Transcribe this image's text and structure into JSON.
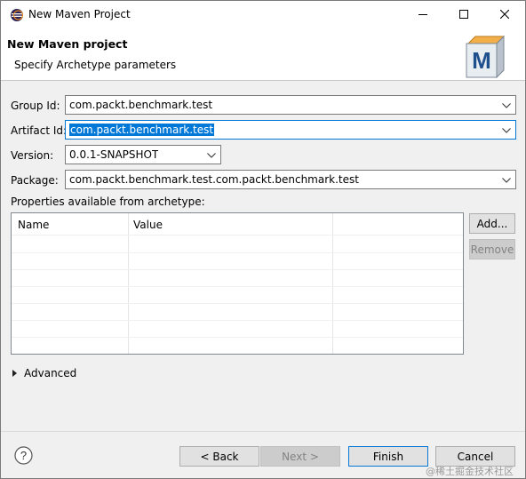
{
  "window": {
    "title": "New Maven Project",
    "controls": {
      "minimize": "minimize",
      "maximize": "maximize",
      "close": "close"
    }
  },
  "header": {
    "title": "New Maven project",
    "description": "Specify Archetype parameters",
    "logo_letter": "M"
  },
  "form": {
    "group_id": {
      "label": "Group Id:",
      "value": "com.packt.benchmark.test"
    },
    "artifact_id": {
      "label": "Artifact Id:",
      "value": "com.packt.benchmark.test"
    },
    "version": {
      "label": "Version:",
      "value": "0.0.1-SNAPSHOT"
    },
    "package": {
      "label": "Package:",
      "value": "com.packt.benchmark.test.com.packt.benchmark.test"
    }
  },
  "properties": {
    "label": "Properties available from archetype:",
    "columns": [
      "Name",
      "Value"
    ],
    "rows": [],
    "add_button": "Add...",
    "remove_button": "Remove"
  },
  "advanced": {
    "label": "Advanced"
  },
  "footer": {
    "back": "< Back",
    "next": "Next >",
    "finish": "Finish",
    "cancel": "Cancel"
  },
  "watermark": "@稀土掘金技术社区",
  "colors": {
    "accent": "#0078d7",
    "button_bg": "#e1e1e1",
    "disabled": "#838383"
  }
}
